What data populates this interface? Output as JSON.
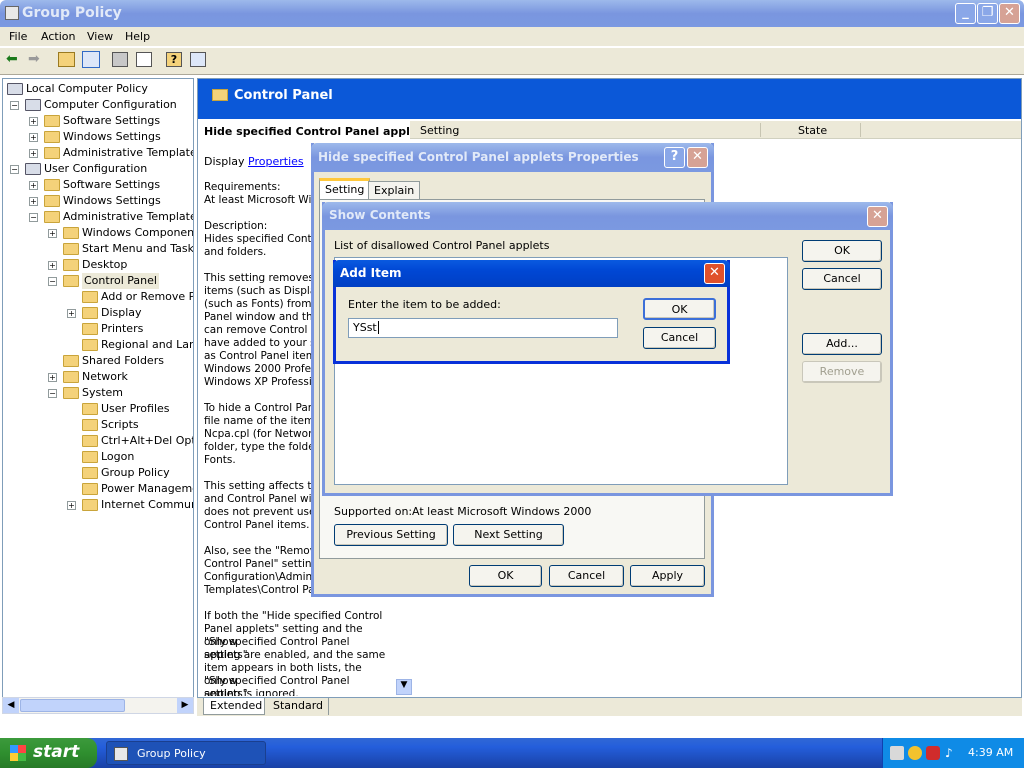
{
  "window": {
    "title": "Group Policy"
  },
  "menu": [
    "File",
    "Action",
    "View",
    "Help"
  ],
  "tree": [
    {
      "label": "Local Computer Policy"
    },
    {
      "label": "Computer Configuration"
    },
    {
      "label": "Software Settings"
    },
    {
      "label": "Windows Settings"
    },
    {
      "label": "Administrative Templates"
    },
    {
      "label": "User Configuration"
    },
    {
      "label": "Software Settings"
    },
    {
      "label": "Windows Settings"
    },
    {
      "label": "Administrative Templates"
    },
    {
      "label": "Windows Components"
    },
    {
      "label": "Start Menu and Taskba"
    },
    {
      "label": "Desktop"
    },
    {
      "label": "Control Panel"
    },
    {
      "label": "Add or Remove Pro"
    },
    {
      "label": "Display"
    },
    {
      "label": "Printers"
    },
    {
      "label": "Regional and Langu"
    },
    {
      "label": "Shared Folders"
    },
    {
      "label": "Network"
    },
    {
      "label": "System"
    },
    {
      "label": "User Profiles"
    },
    {
      "label": "Scripts"
    },
    {
      "label": "Ctrl+Alt+Del Optio"
    },
    {
      "label": "Logon"
    },
    {
      "label": "Group Policy"
    },
    {
      "label": "Power Managemen"
    },
    {
      "label": "Internet Communic"
    }
  ],
  "right": {
    "header": "Control Panel",
    "setting_title": "Hide specified Control Panel applets",
    "display_label": "Display",
    "display_link": "Properties",
    "desc": [
      "Requirements:",
      "At least Microsoft Windo",
      "",
      "Description:",
      "Hides specified Control",
      "and folders.",
      "",
      "This setting removes C",
      "items (such as Display)",
      "(such as Fonts) from t",
      "Panel window and the",
      "can remove Control Pa",
      "have added to your sy",
      "as Control Panel items",
      "Windows 2000 Profess",
      "Windows XP Professio",
      "",
      "To hide a Control Pane",
      "file name of the item, s",
      "Ncpa.cpl (for Network)",
      "folder, type the folder",
      "Fonts.",
      "",
      "This setting affects the",
      "and Control Panel wind",
      "does not prevent user",
      "Control Panel items.",
      "",
      "Also, see the \"Remove",
      "Control Panel\" setting",
      "Configuration\\Adminis",
      "Templates\\Control Pa",
      "",
      "If both the \"Hide specified Control",
      "Panel applets\" setting and the \"Show",
      "only specified Control Panel applets\"",
      "setting are enabled, and the same",
      "item appears in both lists, the \"Show",
      "only specified Control Panel applets\"",
      "setting is ignored."
    ],
    "col_setting": "Setting",
    "col_state": "State",
    "tab_extended": "Extended",
    "tab_standard": "Standard"
  },
  "props": {
    "title": "Hide specified Control Panel applets Properties",
    "tab_setting": "Setting",
    "tab_explain": "Explain",
    "supported_label": "Supported on:",
    "supported_value": "At least Microsoft Windows 2000",
    "prev": "Previous Setting",
    "next": "Next Setting",
    "ok": "OK",
    "cancel": "Cancel",
    "apply": "Apply"
  },
  "show": {
    "title": "Show Contents",
    "list_label": "List of disallowed Control Panel applets",
    "ok": "OK",
    "cancel": "Cancel",
    "add": "Add...",
    "remove": "Remove"
  },
  "add": {
    "title": "Add Item",
    "label": "Enter the item to be added:",
    "value": "YSst",
    "ok": "OK",
    "cancel": "Cancel"
  },
  "taskbar": {
    "start": "start",
    "task": "Group Policy",
    "clock": "4:39 AM"
  }
}
